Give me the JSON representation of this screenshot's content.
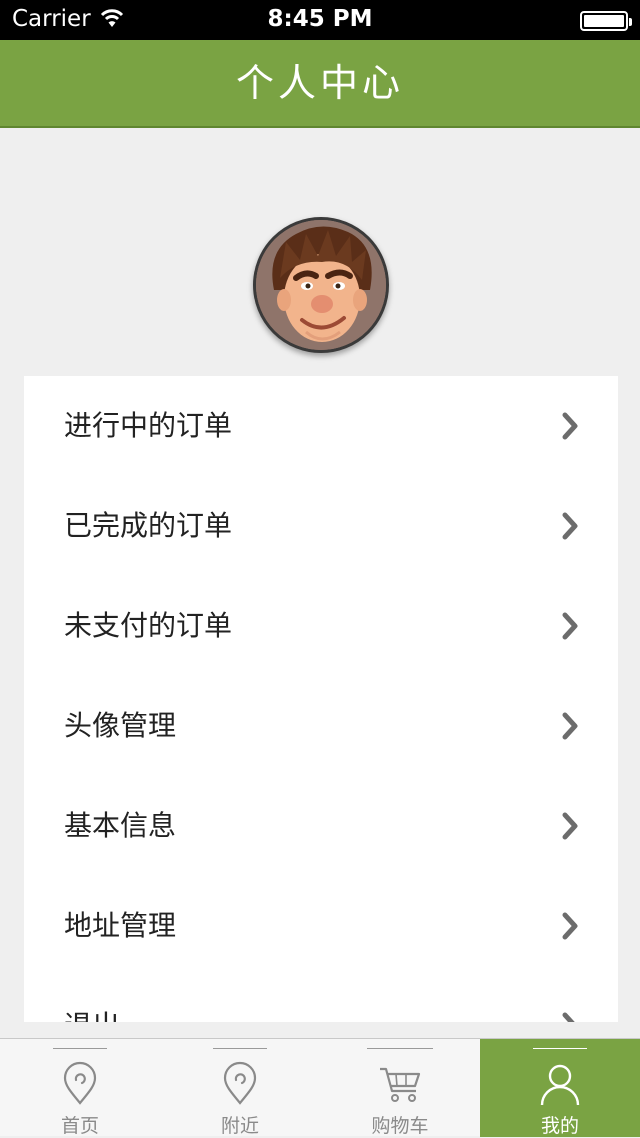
{
  "status_bar": {
    "carrier": "Carrier",
    "time": "8:45 PM"
  },
  "nav_bar": {
    "title": "个人中心",
    "color": "#7aa343"
  },
  "profile": {
    "avatar_icon": "cartoon-face-avatar"
  },
  "menu": {
    "items": [
      {
        "label": "进行中的订单"
      },
      {
        "label": "已完成的订单"
      },
      {
        "label": "未支付的订单"
      },
      {
        "label": "头像管理"
      },
      {
        "label": "基本信息"
      },
      {
        "label": "地址管理"
      },
      {
        "label": "退出"
      }
    ]
  },
  "tab_bar": {
    "tabs": [
      {
        "label": "首页",
        "icon": "location-pin-icon",
        "active": false
      },
      {
        "label": "附近",
        "icon": "location-pin-icon",
        "active": false
      },
      {
        "label": "购物车",
        "icon": "shopping-cart-icon",
        "active": false
      },
      {
        "label": "我的",
        "icon": "person-icon",
        "active": true
      }
    ]
  }
}
